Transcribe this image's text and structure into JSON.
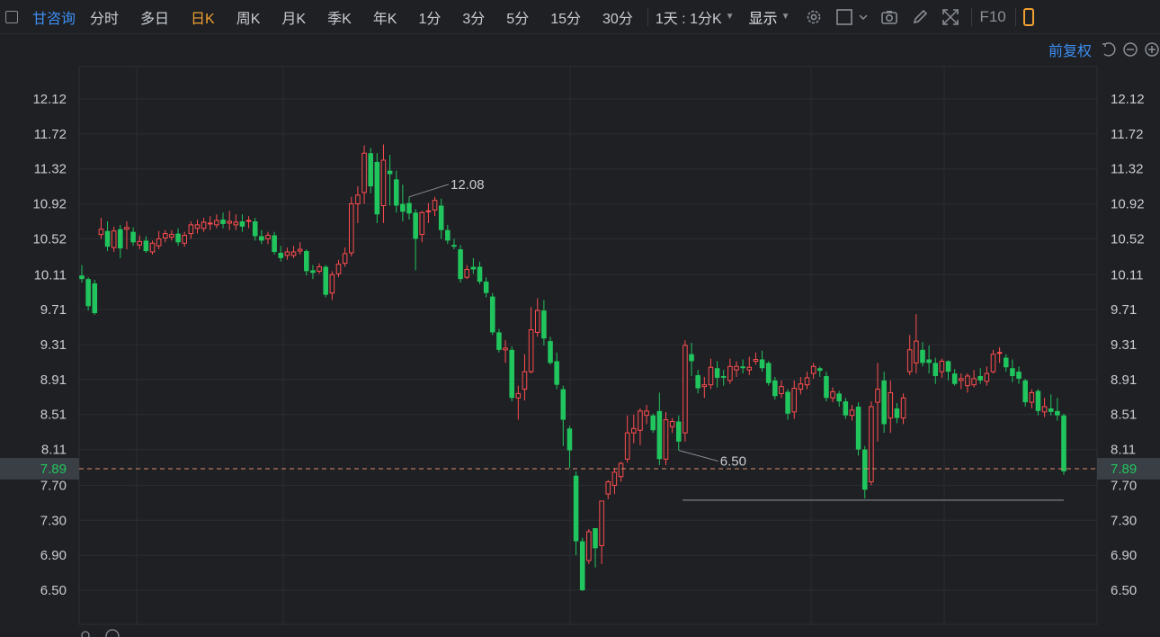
{
  "toolbar": {
    "stock_name": "甘咨询",
    "periods": [
      "分时",
      "多日",
      "日K",
      "周K",
      "月K",
      "季K",
      "年K",
      "1分",
      "3分",
      "5分",
      "15分",
      "30分"
    ],
    "active_period": "日K",
    "interval_dropdown": "1天 : 1分K",
    "display_dropdown": "显示",
    "f10_label": "F10"
  },
  "subbar": {
    "adjust_label": "前复权"
  },
  "colors": {
    "up": "#ff4d4f",
    "down": "#21c55d",
    "accent": "#3d8ef0",
    "active": "#f0a030",
    "current_price_line": "#d98c6a"
  },
  "chart_data": {
    "type": "candlestick",
    "y_ticks": [
      12.12,
      11.72,
      11.32,
      10.92,
      10.52,
      10.11,
      9.71,
      9.31,
      8.91,
      8.51,
      8.11,
      7.7,
      7.3,
      6.9,
      6.5
    ],
    "ylim": [
      6.12,
      12.32
    ],
    "current_price": 7.89,
    "support_line": 7.53,
    "annotations": [
      {
        "label": "12.08",
        "candle_index": 51
      },
      {
        "label": "6.50",
        "candle_index": 93
      }
    ],
    "candles": [
      [
        10.1,
        10.06,
        10.22,
        10.02
      ],
      [
        10.06,
        9.75,
        10.08,
        9.7
      ],
      [
        10.01,
        9.67,
        10.05,
        9.65
      ],
      [
        10.57,
        10.63,
        10.76,
        10.52
      ],
      [
        10.61,
        10.43,
        10.72,
        10.38
      ],
      [
        10.42,
        10.61,
        10.66,
        10.37
      ],
      [
        10.63,
        10.41,
        10.68,
        10.3
      ],
      [
        10.63,
        10.65,
        10.72,
        10.4
      ],
      [
        10.6,
        10.48,
        10.65,
        10.44
      ],
      [
        10.45,
        10.49,
        10.56,
        10.4
      ],
      [
        10.5,
        10.38,
        10.55,
        10.36
      ],
      [
        10.37,
        10.47,
        10.5,
        10.34
      ],
      [
        10.44,
        10.52,
        10.61,
        10.4
      ],
      [
        10.53,
        10.58,
        10.62,
        10.48
      ],
      [
        10.54,
        10.57,
        10.62,
        10.5
      ],
      [
        10.58,
        10.48,
        10.64,
        10.44
      ],
      [
        10.47,
        10.56,
        10.6,
        10.43
      ],
      [
        10.58,
        10.68,
        10.72,
        10.52
      ],
      [
        10.64,
        10.68,
        10.74,
        10.58
      ],
      [
        10.64,
        10.71,
        10.76,
        10.6
      ],
      [
        10.69,
        10.7,
        10.78,
        10.62
      ],
      [
        10.68,
        10.73,
        10.8,
        10.64
      ],
      [
        10.74,
        10.69,
        10.82,
        10.64
      ],
      [
        10.7,
        10.72,
        10.84,
        10.62
      ],
      [
        10.68,
        10.71,
        10.8,
        10.62
      ],
      [
        10.72,
        10.66,
        10.8,
        10.6
      ],
      [
        10.72,
        10.73,
        10.78,
        10.64
      ],
      [
        10.72,
        10.55,
        10.76,
        10.5
      ],
      [
        10.55,
        10.5,
        10.62,
        10.46
      ],
      [
        10.52,
        10.56,
        10.6,
        10.46
      ],
      [
        10.56,
        10.37,
        10.6,
        10.34
      ],
      [
        10.36,
        10.3,
        10.44,
        10.26
      ],
      [
        10.33,
        10.37,
        10.42,
        10.28
      ],
      [
        10.33,
        10.37,
        10.44,
        10.3
      ],
      [
        10.38,
        10.4,
        10.48,
        10.34
      ],
      [
        10.38,
        10.15,
        10.4,
        10.1
      ],
      [
        10.16,
        10.13,
        10.22,
        10.06
      ],
      [
        10.15,
        10.2,
        10.24,
        10.12
      ],
      [
        10.2,
        9.88,
        10.22,
        9.85
      ],
      [
        9.9,
        10.11,
        10.15,
        9.82
      ],
      [
        10.12,
        10.23,
        10.28,
        10.08
      ],
      [
        10.24,
        10.35,
        10.42,
        10.2
      ],
      [
        10.36,
        10.92,
        11.0,
        10.32
      ],
      [
        10.92,
        11.02,
        11.12,
        10.7
      ],
      [
        11.05,
        11.5,
        11.59,
        10.92
      ],
      [
        11.5,
        11.12,
        11.56,
        11.04
      ],
      [
        11.4,
        10.8,
        11.5,
        10.7
      ],
      [
        10.9,
        11.42,
        11.6,
        10.7
      ],
      [
        11.3,
        11.26,
        11.48,
        10.9
      ],
      [
        11.2,
        10.9,
        11.3,
        10.82
      ],
      [
        10.92,
        10.83,
        11.14,
        10.72
      ],
      [
        10.93,
        10.81,
        11.0,
        10.74
      ],
      [
        10.82,
        10.52,
        10.86,
        10.16
      ],
      [
        10.57,
        10.82,
        10.84,
        10.48
      ],
      [
        10.84,
        10.84,
        10.93,
        10.7
      ],
      [
        10.85,
        10.96,
        11.0,
        10.78
      ],
      [
        10.9,
        10.62,
        10.98,
        10.52
      ],
      [
        10.62,
        10.5,
        10.68,
        10.46
      ],
      [
        10.45,
        10.43,
        10.52,
        10.4
      ],
      [
        10.4,
        10.06,
        10.45,
        10.02
      ],
      [
        10.08,
        10.17,
        10.22,
        10.06
      ],
      [
        10.2,
        10.17,
        10.3,
        10.12
      ],
      [
        10.2,
        10.03,
        10.26,
        10.0
      ],
      [
        10.03,
        9.9,
        10.08,
        9.85
      ],
      [
        9.86,
        9.45,
        9.9,
        9.42
      ],
      [
        9.45,
        9.25,
        9.49,
        9.22
      ],
      [
        9.25,
        9.27,
        9.36,
        9.1
      ],
      [
        9.25,
        8.7,
        9.29,
        8.66
      ],
      [
        8.7,
        8.75,
        8.84,
        8.45
      ],
      [
        8.8,
        9.0,
        9.2,
        8.67
      ],
      [
        9.0,
        9.48,
        9.74,
        8.98
      ],
      [
        9.45,
        9.7,
        9.84,
        9.4
      ],
      [
        9.7,
        9.38,
        9.82,
        9.3
      ],
      [
        9.35,
        9.1,
        9.4,
        9.08
      ],
      [
        9.12,
        8.85,
        9.22,
        8.8
      ],
      [
        8.8,
        8.45,
        8.84,
        8.15
      ],
      [
        8.35,
        8.1,
        8.38,
        7.9
      ],
      [
        7.81,
        7.06,
        7.86,
        6.9
      ],
      [
        7.06,
        6.5,
        7.1,
        6.49
      ],
      [
        6.84,
        7.17,
        7.2,
        6.8
      ],
      [
        7.21,
        6.98,
        7.21,
        6.76
      ],
      [
        7.01,
        7.52,
        7.52,
        6.8
      ],
      [
        7.6,
        7.74,
        7.76,
        7.54
      ],
      [
        7.7,
        7.85,
        7.9,
        7.6
      ],
      [
        7.8,
        7.95,
        7.97,
        7.74
      ],
      [
        8.0,
        8.3,
        8.5,
        7.96
      ],
      [
        8.3,
        8.35,
        8.51,
        8.18
      ],
      [
        8.33,
        8.55,
        8.58,
        8.16
      ],
      [
        8.5,
        8.55,
        8.62,
        8.4
      ],
      [
        8.5,
        8.33,
        8.52,
        8.3
      ],
      [
        8.55,
        8.0,
        8.76,
        7.93
      ],
      [
        8.0,
        8.45,
        8.54,
        7.93
      ],
      [
        8.37,
        8.43,
        8.47,
        8.3
      ],
      [
        8.43,
        8.2,
        8.5,
        8.1
      ],
      [
        8.3,
        9.3,
        9.36,
        8.2
      ],
      [
        9.2,
        9.12,
        9.33,
        8.95
      ],
      [
        8.96,
        8.81,
        9.02,
        8.75
      ],
      [
        8.83,
        8.85,
        8.94,
        8.7
      ],
      [
        8.85,
        9.05,
        9.15,
        8.8
      ],
      [
        9.04,
        8.93,
        9.12,
        8.82
      ],
      [
        8.95,
        8.93,
        9.02,
        8.84
      ],
      [
        8.9,
        9.06,
        9.15,
        8.86
      ],
      [
        9.02,
        9.06,
        9.12,
        8.94
      ],
      [
        9.06,
        9.04,
        9.14,
        8.98
      ],
      [
        9.02,
        9.05,
        9.17,
        8.96
      ],
      [
        9.12,
        9.14,
        9.22,
        9.08
      ],
      [
        9.14,
        9.04,
        9.24,
        9.0
      ],
      [
        9.1,
        8.87,
        9.12,
        8.84
      ],
      [
        8.9,
        8.72,
        8.94,
        8.68
      ],
      [
        8.75,
        8.83,
        8.9,
        8.7
      ],
      [
        8.77,
        8.52,
        8.8,
        8.45
      ],
      [
        8.54,
        8.81,
        8.9,
        8.46
      ],
      [
        8.8,
        8.86,
        8.94,
        8.74
      ],
      [
        8.85,
        8.93,
        9.0,
        8.8
      ],
      [
        8.98,
        9.06,
        9.1,
        8.92
      ],
      [
        9.04,
        9.01,
        9.06,
        8.94
      ],
      [
        8.95,
        8.7,
        9.0,
        8.66
      ],
      [
        8.7,
        8.77,
        8.82,
        8.65
      ],
      [
        8.75,
        8.66,
        8.78,
        8.6
      ],
      [
        8.66,
        8.5,
        8.7,
        8.46
      ],
      [
        8.5,
        8.56,
        8.62,
        8.44
      ],
      [
        8.6,
        8.11,
        8.65,
        8.04
      ],
      [
        8.11,
        7.65,
        8.15,
        7.55
      ],
      [
        7.74,
        8.6,
        8.66,
        7.7
      ],
      [
        8.65,
        8.8,
        9.1,
        8.2
      ],
      [
        8.9,
        8.4,
        9.0,
        8.3
      ],
      [
        8.47,
        8.76,
        8.9,
        8.3
      ],
      [
        8.58,
        8.47,
        8.64,
        8.41
      ],
      [
        8.47,
        8.7,
        8.75,
        8.4
      ],
      [
        9.0,
        9.25,
        9.42,
        8.96
      ],
      [
        9.1,
        9.35,
        9.66,
        8.98
      ],
      [
        9.25,
        9.1,
        9.34,
        9.06
      ],
      [
        9.14,
        9.1,
        9.3,
        8.98
      ],
      [
        9.1,
        8.95,
        9.16,
        8.86
      ],
      [
        9.0,
        9.12,
        9.15,
        8.93
      ],
      [
        9.12,
        9.0,
        9.13,
        8.9
      ],
      [
        8.98,
        8.86,
        9.03,
        8.84
      ],
      [
        8.9,
        8.92,
        8.98,
        8.8
      ],
      [
        8.84,
        8.95,
        8.98,
        8.76
      ],
      [
        8.85,
        8.92,
        9.02,
        8.82
      ],
      [
        8.95,
        8.9,
        9.04,
        8.86
      ],
      [
        8.89,
        8.98,
        9.06,
        8.84
      ],
      [
        9.0,
        9.2,
        9.25,
        8.98
      ],
      [
        9.22,
        9.22,
        9.28,
        9.1
      ],
      [
        9.16,
        9.05,
        9.2,
        9.0
      ],
      [
        9.04,
        8.95,
        9.14,
        8.88
      ],
      [
        9.0,
        8.92,
        9.06,
        8.86
      ],
      [
        8.9,
        8.65,
        8.92,
        8.6
      ],
      [
        8.65,
        8.76,
        8.8,
        8.58
      ],
      [
        8.78,
        8.55,
        8.8,
        8.5
      ],
      [
        8.54,
        8.6,
        8.7,
        8.48
      ],
      [
        8.58,
        8.54,
        8.74,
        8.5
      ],
      [
        8.55,
        8.5,
        8.7,
        8.44
      ],
      [
        8.5,
        7.86,
        8.52,
        7.82
      ]
    ]
  }
}
